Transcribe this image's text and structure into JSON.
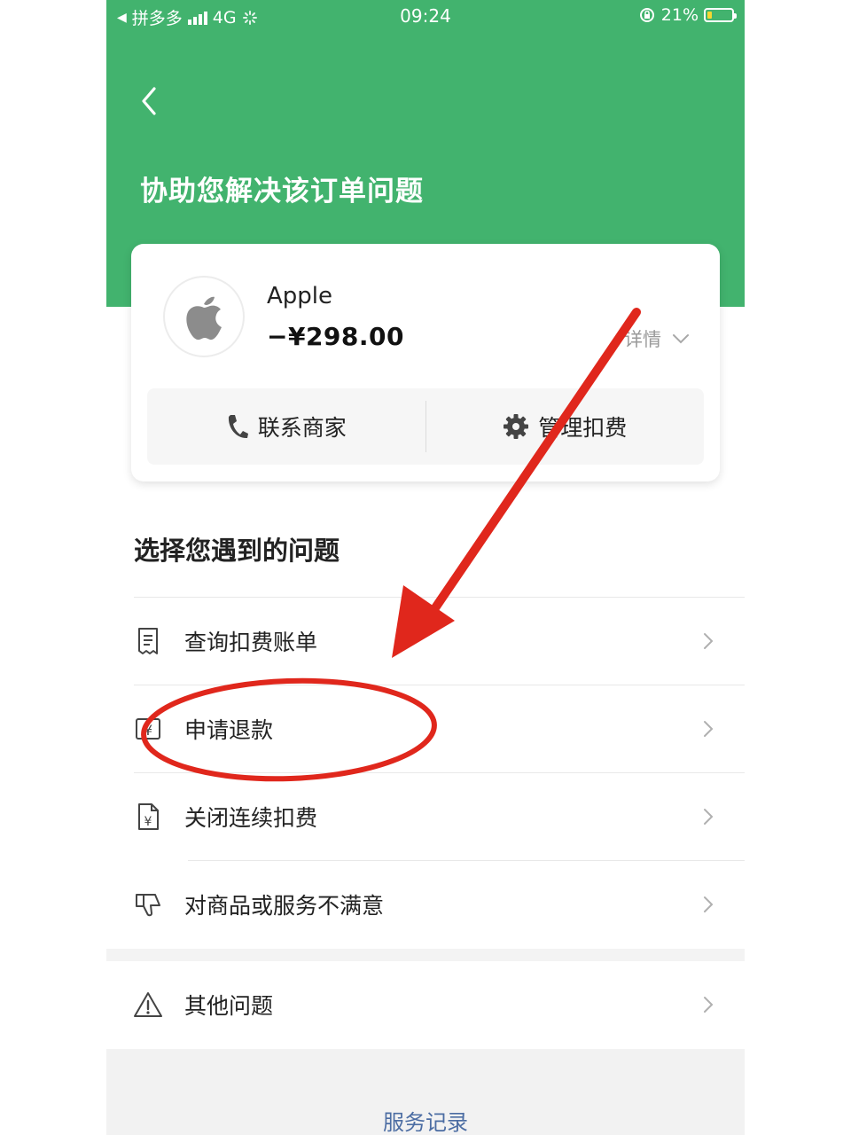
{
  "status_bar": {
    "carrier": "拼多多",
    "network": "4G",
    "time": "09:24",
    "battery": "21%",
    "battery_level": 0.21
  },
  "header": {
    "back_icon": "chevron-left-icon",
    "title": "协助您解决该订单问题"
  },
  "order_card": {
    "merchant_icon": "apple-logo-icon",
    "merchant_name": "Apple",
    "amount": "−¥298.00",
    "details_label": "详情",
    "actions": [
      {
        "icon": "phone-icon",
        "label": "联系商家"
      },
      {
        "icon": "gear-icon",
        "label": "管理扣费"
      }
    ]
  },
  "issues": {
    "title": "选择您遇到的问题",
    "items": [
      {
        "icon": "receipt-icon",
        "label": "查询扣费账单"
      },
      {
        "icon": "refund-icon",
        "label": "申请退款"
      },
      {
        "icon": "yuan-document-icon",
        "label": "关闭连续扣费"
      },
      {
        "icon": "thumbs-down-icon",
        "label": "对商品或服务不满意"
      }
    ],
    "other": {
      "icon": "warning-icon",
      "label": "其他问题"
    }
  },
  "footer": {
    "service_records_label": "服务记录"
  },
  "colors": {
    "header_green": "#42b36e",
    "annotation_red": "#e0271c",
    "link_blue": "#4c6da3"
  }
}
